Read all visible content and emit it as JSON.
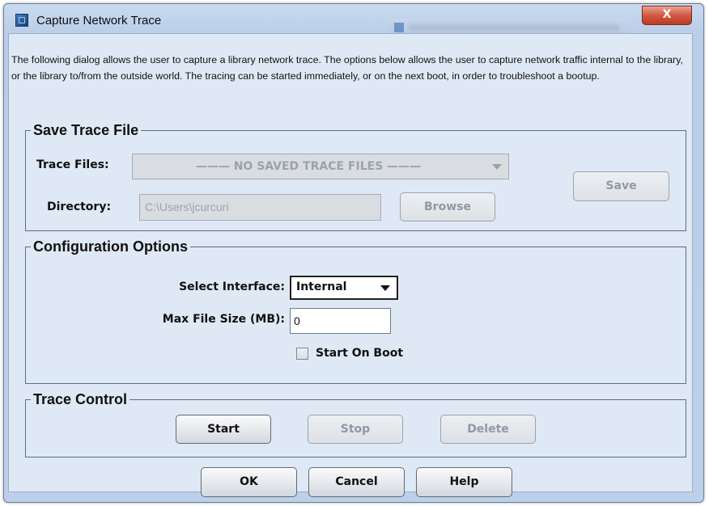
{
  "window": {
    "title": "Capture Network Trace",
    "close_symbol": "X"
  },
  "description": "The following dialog allows the user to capture a library network trace. The options below allows the user to capture network traffic internal to the library, or the library to/from the outside world. The tracing can be started immediately, or on the next boot, in order to troubleshoot a bootup.",
  "save_trace": {
    "legend": "Save Trace File",
    "trace_files_label": "Trace Files:",
    "trace_files_value": "——— NO SAVED TRACE FILES ———",
    "directory_label": "Directory:",
    "directory_value": "C:\\Users\\jcurcuri",
    "browse_label": "Browse",
    "save_label": "Save"
  },
  "config": {
    "legend": "Configuration Options",
    "interface_label": "Select Interface:",
    "interface_value": "Internal",
    "max_size_label": "Max File Size (MB):",
    "max_size_value": "0",
    "start_on_boot_label": "Start On Boot",
    "start_on_boot_checked": false
  },
  "trace_control": {
    "legend": "Trace Control",
    "start_label": "Start",
    "stop_label": "Stop",
    "delete_label": "Delete"
  },
  "footer": {
    "ok_label": "OK",
    "cancel_label": "Cancel",
    "help_label": "Help"
  },
  "icons": {
    "app": "network-trace-app-icon",
    "close": "close-icon",
    "dropdown": "chevron-down-icon",
    "checkbox": "checkbox-unchecked-icon"
  },
  "colors": {
    "titlebar": "#c9daef",
    "dialog_bg": "#dfe9f5",
    "close_button": "#cf5a41",
    "disabled_text": "#9aa2ab"
  }
}
